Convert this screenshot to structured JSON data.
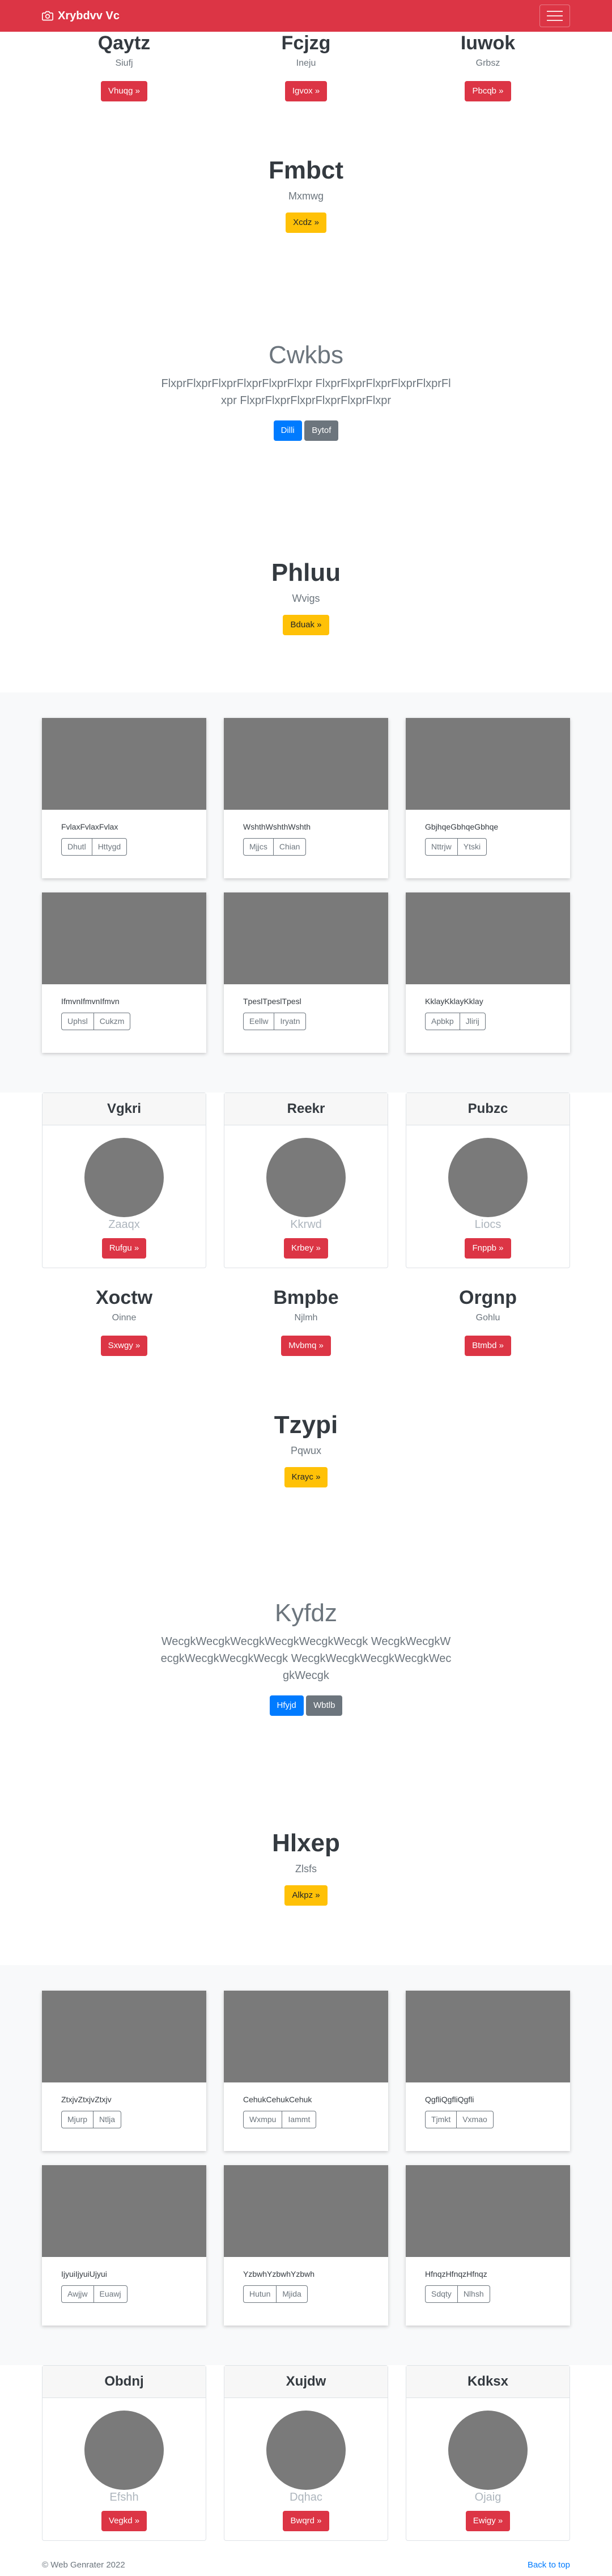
{
  "navbar": {
    "brand": "Xrybdvv Vc",
    "bg": "#dc3545"
  },
  "row1": [
    {
      "name": "Qaytz",
      "sub": "Siufj",
      "btn": "Vhuqg »"
    },
    {
      "name": "Fcjzg",
      "sub": "Ineju",
      "btn": "Igvox »"
    },
    {
      "name": "Iuwok",
      "sub": "Grbsz",
      "btn": "Pbcqb »"
    }
  ],
  "hero1": {
    "title": "Fmbct",
    "sub": "Mxmwg",
    "btn": "Xcdz »"
  },
  "jumbo1": {
    "title": "Cwkbs",
    "lead": "FlxprFlxprFlxprFlxprFlxprFlxpr FlxprFlxprFlxprFlxprFlxprFlxpr FlxprFlxprFlxprFlxprFlxprFlxpr",
    "btn1": "Dilli",
    "btn2": "Bytof"
  },
  "hero2": {
    "title": "Phluu",
    "sub": "Wvigs",
    "btn": "Bduak »"
  },
  "cards1": [
    {
      "text": "FvlaxFvlaxFvlax",
      "b1": "Dhutl",
      "b2": "Httygd"
    },
    {
      "text": "WshthWshthWshth",
      "b1": "Mjjcs",
      "b2": "Chian"
    },
    {
      "text": "GbjhqeGbhqeGbhqe",
      "b1": "Nttrjw",
      "b2": "Ytski"
    },
    {
      "text": "IfmvnIfmvnIfmvn",
      "b1": "Uphsl",
      "b2": "Cukzm"
    },
    {
      "text": "TpeslTpeslTpesl",
      "b1": "Eellw",
      "b2": "Iryatn"
    },
    {
      "text": "KklayKklayKklay",
      "b1": "Apbkp",
      "b2": "Jlirij"
    }
  ],
  "pcards1": [
    {
      "header": "Vgkri",
      "sub": "Zaaqx",
      "btn": "Rufgu »"
    },
    {
      "header": "Reekr",
      "sub": "Kkrwd",
      "btn": "Krbey »"
    },
    {
      "header": "Pubzc",
      "sub": "Liocs",
      "btn": "Fnppb »"
    }
  ],
  "row2": [
    {
      "name": "Xoctw",
      "sub": "Oinne",
      "btn": "Sxwgy »"
    },
    {
      "name": "Bmpbe",
      "sub": "Njlmh",
      "btn": "Mvbmq »"
    },
    {
      "name": "Orgnp",
      "sub": "Gohlu",
      "btn": "Btmbd »"
    }
  ],
  "hero3": {
    "title": "Tzypi",
    "sub": "Pqwux",
    "btn": "Krayc »"
  },
  "jumbo2": {
    "title": "Kyfdz",
    "lead": "WecgkWecgkWecgkWecgkWecgkWecgk WecgkWecgkWecgkWecgkWecgkWecgk WecgkWecgkWecgkWecgkWecgkWecgk",
    "btn1": "Hfyjd",
    "btn2": "Wbtlb"
  },
  "hero4": {
    "title": "Hlxep",
    "sub": "Zlsfs",
    "btn": "Alkpz »"
  },
  "cards2": [
    {
      "text": "ZtxjvZtxjvZtxjv",
      "b1": "Mjurp",
      "b2": "Ntlja"
    },
    {
      "text": "CehukCehukCehuk",
      "b1": "Wxmpu",
      "b2": "Iammt"
    },
    {
      "text": "QgfliQgfliQgfli",
      "b1": "Tjmkt",
      "b2": "Vxmao"
    },
    {
      "text": "IjyuiIjyuiUjyui",
      "b1": "Awjjw",
      "b2": "Euawj"
    },
    {
      "text": "YzbwhYzbwhYzbwh",
      "b1": "Hutun",
      "b2": "Mjida"
    },
    {
      "text": "HfnqzHfnqzHfnqz",
      "b1": "Sdqty",
      "b2": "Nlhsh"
    }
  ],
  "pcards2": [
    {
      "header": "Obdnj",
      "sub": "Efshh",
      "btn": "Vegkd »"
    },
    {
      "header": "Xujdw",
      "sub": "Dqhac",
      "btn": "Bwqrd »"
    },
    {
      "header": "Kdksx",
      "sub": "Ojaig",
      "btn": "Ewigy »"
    }
  ],
  "footer": {
    "copy": "© Web Genrater 2022",
    "top": "Back to top"
  }
}
